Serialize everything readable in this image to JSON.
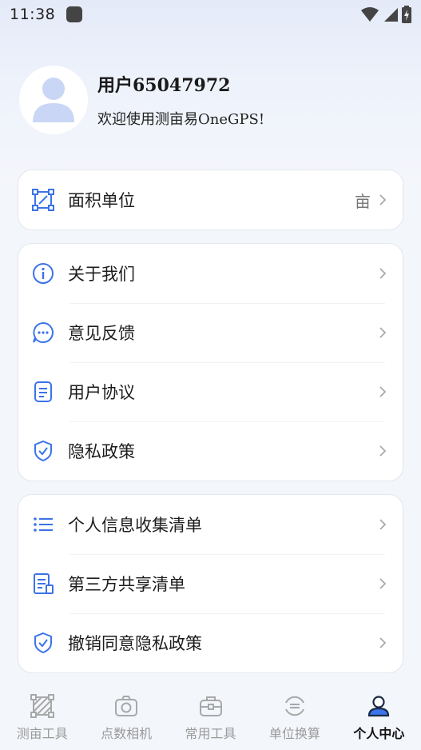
{
  "status_bar": {
    "time": "11:38"
  },
  "profile": {
    "name": "用户65047972",
    "welcome": "欢迎使用测亩易OneGPS!"
  },
  "card_area": {
    "items": [
      {
        "label": "面积单位",
        "value": "亩",
        "icon": "area-unit-icon"
      }
    ]
  },
  "card_about": {
    "items": [
      {
        "label": "关于我们",
        "icon": "info-icon"
      },
      {
        "label": "意见反馈",
        "icon": "feedback-icon"
      },
      {
        "label": "用户协议",
        "icon": "document-icon"
      },
      {
        "label": "隐私政策",
        "icon": "shield-icon"
      }
    ]
  },
  "card_privacy": {
    "items": [
      {
        "label": "个人信息收集清单",
        "icon": "list-icon"
      },
      {
        "label": "第三方共享清单",
        "icon": "share-list-icon"
      },
      {
        "label": "撤销同意隐私政策",
        "icon": "shield-revoke-icon"
      }
    ]
  },
  "tabbar": {
    "tabs": [
      {
        "label": "测亩工具",
        "icon": "measure-icon",
        "active": false
      },
      {
        "label": "点数相机",
        "icon": "camera-icon",
        "active": false
      },
      {
        "label": "常用工具",
        "icon": "toolbox-icon",
        "active": false
      },
      {
        "label": "单位换算",
        "icon": "convert-icon",
        "active": false
      },
      {
        "label": "个人中心",
        "icon": "person-icon",
        "active": true
      }
    ]
  },
  "colors": {
    "accent": "#3b73e8",
    "tab_inactive": "#9a9a9a",
    "tab_active": "#111111"
  }
}
